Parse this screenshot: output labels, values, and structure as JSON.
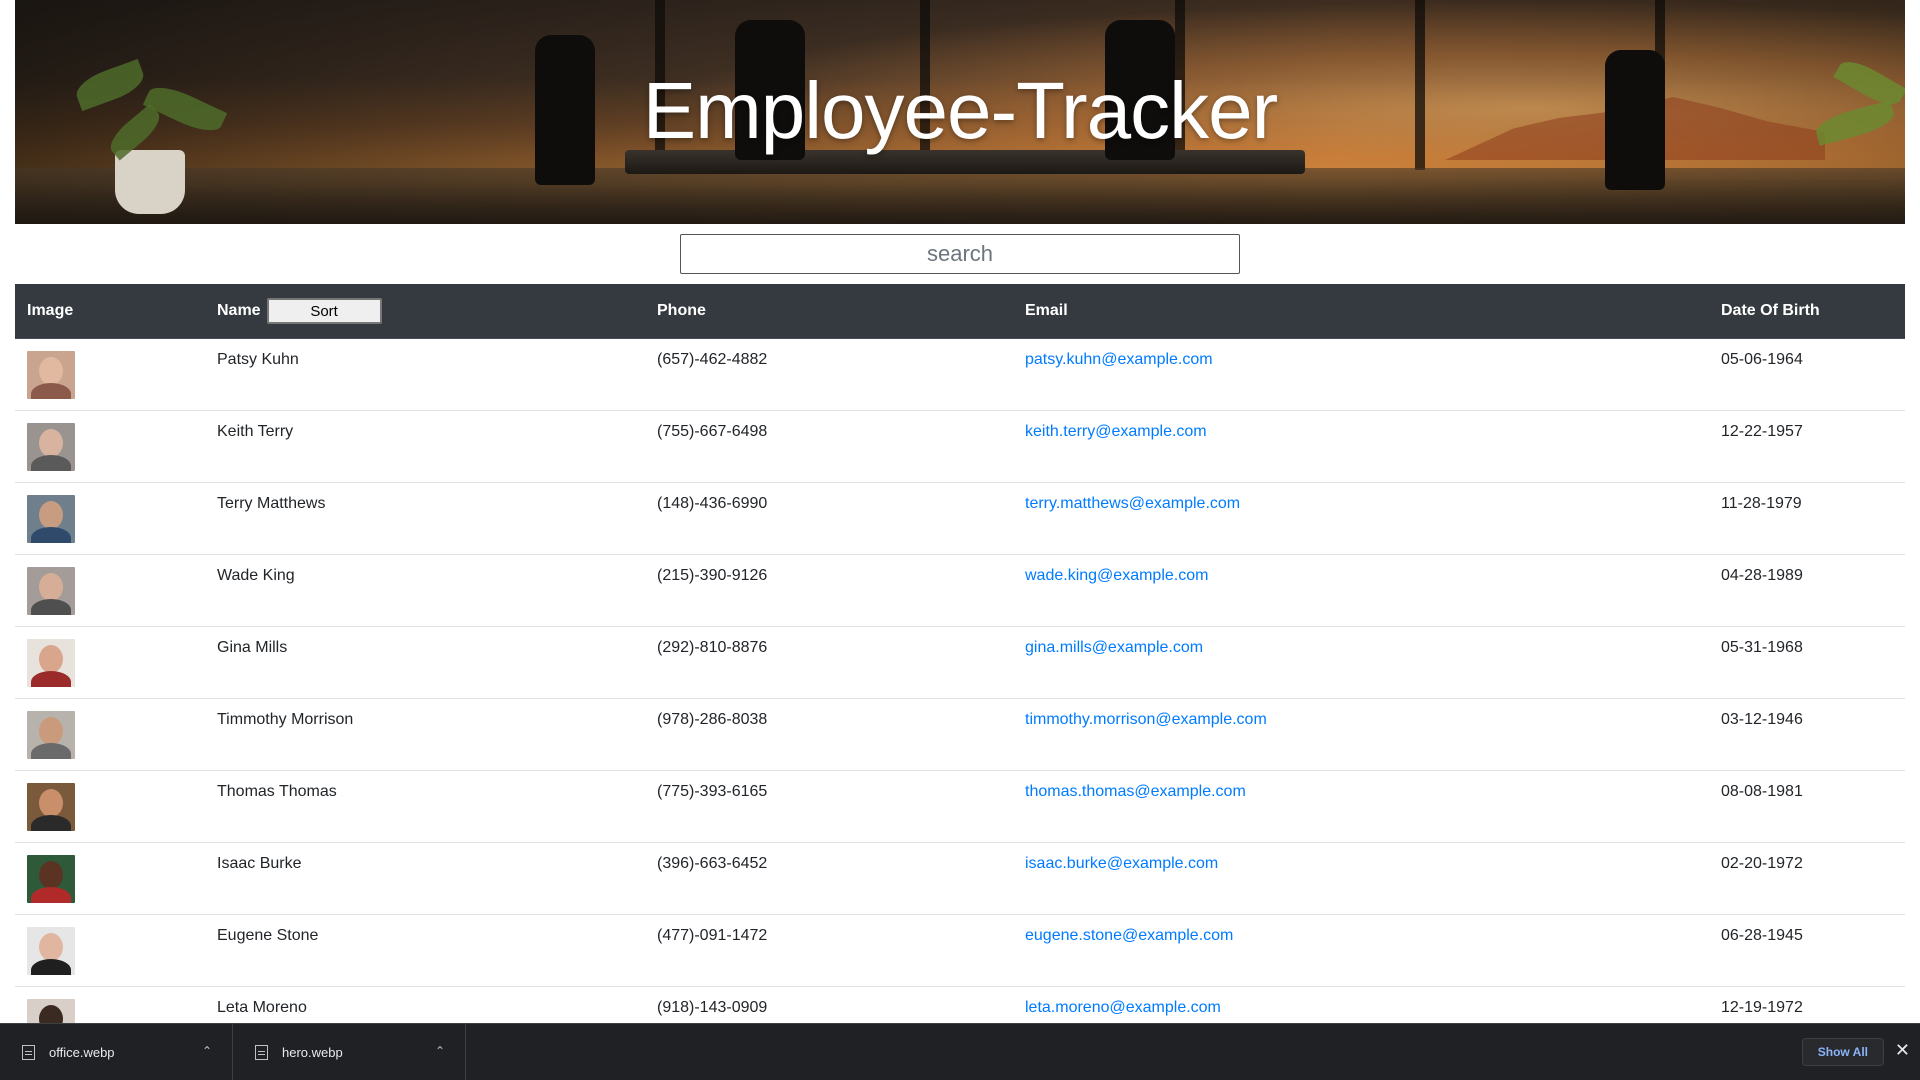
{
  "header": {
    "title": "Employee-Tracker"
  },
  "search": {
    "placeholder": "search"
  },
  "table": {
    "columns": {
      "image": "Image",
      "name": "Name",
      "phone": "Phone",
      "email": "Email",
      "dob": "Date Of Birth"
    },
    "sort_label": "Sort",
    "rows": [
      {
        "name": "Patsy Kuhn",
        "phone": "(657)-462-4882",
        "email": "patsy.kuhn@example.com",
        "dob": "05-06-1964"
      },
      {
        "name": "Keith Terry",
        "phone": "(755)-667-6498",
        "email": "keith.terry@example.com",
        "dob": "12-22-1957"
      },
      {
        "name": "Terry Matthews",
        "phone": "(148)-436-6990",
        "email": "terry.matthews@example.com",
        "dob": "11-28-1979"
      },
      {
        "name": "Wade King",
        "phone": "(215)-390-9126",
        "email": "wade.king@example.com",
        "dob": "04-28-1989"
      },
      {
        "name": "Gina Mills",
        "phone": "(292)-810-8876",
        "email": "gina.mills@example.com",
        "dob": "05-31-1968"
      },
      {
        "name": "Timmothy Morrison",
        "phone": "(978)-286-8038",
        "email": "timmothy.morrison@example.com",
        "dob": "03-12-1946"
      },
      {
        "name": "Thomas Thomas",
        "phone": "(775)-393-6165",
        "email": "thomas.thomas@example.com",
        "dob": "08-08-1981"
      },
      {
        "name": "Isaac Burke",
        "phone": "(396)-663-6452",
        "email": "isaac.burke@example.com",
        "dob": "02-20-1972"
      },
      {
        "name": "Eugene Stone",
        "phone": "(477)-091-1472",
        "email": "eugene.stone@example.com",
        "dob": "06-28-1945"
      },
      {
        "name": "Leta Moreno",
        "phone": "(918)-143-0909",
        "email": "leta.moreno@example.com",
        "dob": "12-19-1972"
      }
    ]
  },
  "downloads": {
    "items": [
      {
        "filename": "office.webp"
      },
      {
        "filename": "hero.webp"
      }
    ],
    "show_all": "Show All"
  }
}
